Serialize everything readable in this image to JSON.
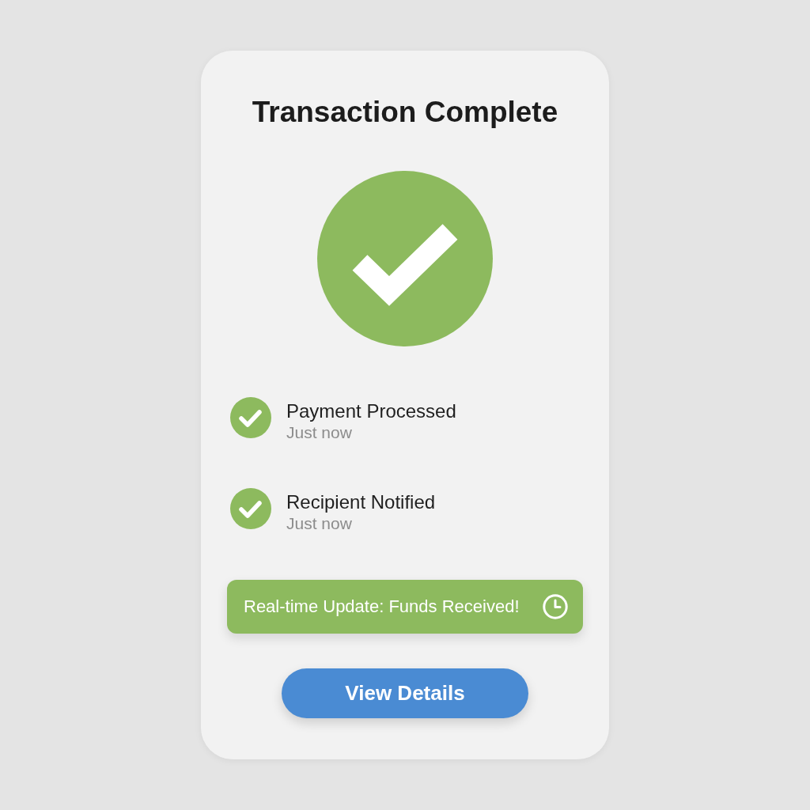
{
  "card": {
    "title": "Transaction Complete",
    "complete": true
  },
  "steps": [
    {
      "label": "Payment Processed",
      "time": "Just now",
      "done": true
    },
    {
      "label": "Recipient Notified",
      "time": "Just now",
      "done": true
    }
  ],
  "banner": {
    "text": "Real-time Update: Funds Received!"
  },
  "button": {
    "label": "View Details"
  }
}
